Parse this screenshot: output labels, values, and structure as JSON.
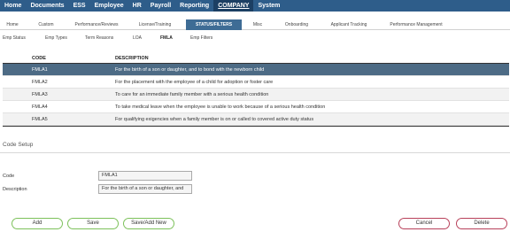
{
  "topnav": {
    "items": [
      "Home",
      "Documents",
      "ESS",
      "Employee",
      "HR",
      "Payroll",
      "Reporting",
      "COMPANY",
      "System"
    ],
    "active_index": 7
  },
  "module_tabs": {
    "items": [
      "Home",
      "Custom",
      "Performance/Reviews",
      "License/Training",
      "STATUS/FILTERS",
      "Misc",
      "Onboarding",
      "Applicant Tracking",
      "Performance Management"
    ],
    "active_index": 4
  },
  "sub_tabs": {
    "items": [
      "Emp Status",
      "Emp Types",
      "Term Reasons",
      "LOA",
      "FMLA",
      "Emp Filters"
    ],
    "active_index": 4
  },
  "table": {
    "columns": [
      "CODE",
      "DESCRIPTION"
    ],
    "rows": [
      {
        "code": "FMLA1",
        "description": "For the birth of a son or daughter, and to bond with the newborn child"
      },
      {
        "code": "FMLA2",
        "description": "For the placement with the employee of a child for adoption or foster care"
      },
      {
        "code": "FMLA3",
        "description": "To care for an immediate family member with a serious health condition"
      },
      {
        "code": "FMLA4",
        "description": "To take medical leave when the employee is unable to work because of a serious health condition"
      },
      {
        "code": "FMLA5",
        "description": "For qualifying exigencies when a family member is on or called to covered active duty status"
      }
    ],
    "selected_index": 0
  },
  "code_setup": {
    "title": "Code Setup",
    "code_label": "Code",
    "code_value": "FMLA1",
    "description_label": "Description",
    "description_value": "For the birth of a son or daughter, and"
  },
  "buttons": {
    "add": "Add",
    "save": "Save",
    "save_add_new": "Save/Add New",
    "cancel": "Cancel",
    "delete": "Delete"
  },
  "colors": {
    "nav_bg": "#2e5d8a",
    "selected_row": "#4d6b85",
    "primary_button_border": "#7cc15a",
    "danger_button_border": "#b8405a"
  }
}
